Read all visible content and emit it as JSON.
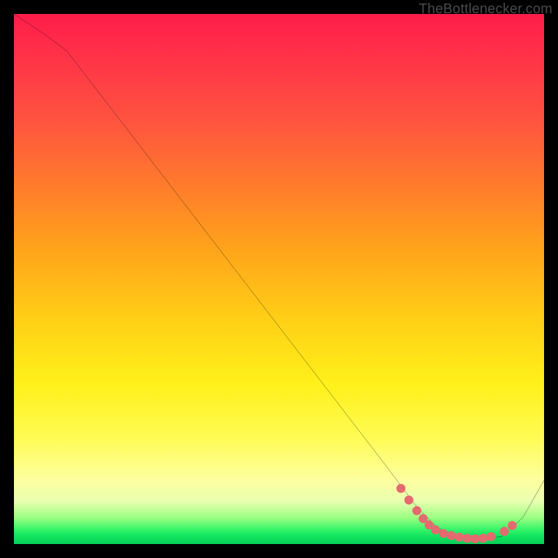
{
  "watermark": "TheBottlenecker.com",
  "chart_data": {
    "type": "line",
    "title": "",
    "xlabel": "",
    "ylabel": "",
    "xlim": [
      0,
      100
    ],
    "ylim": [
      0,
      100
    ],
    "series": [
      {
        "name": "curve",
        "x": [
          0,
          6,
          10,
          20,
          30,
          40,
          50,
          60,
          70,
          76,
          80,
          84,
          88,
          92,
          96,
          100
        ],
        "y": [
          100,
          96,
          93,
          80,
          67,
          54,
          41,
          28,
          15,
          7,
          3,
          1.4,
          1.0,
          1.4,
          5,
          12
        ]
      }
    ],
    "markers": [
      {
        "x": 73.0,
        "y": 10.5
      },
      {
        "x": 74.5,
        "y": 8.3
      },
      {
        "x": 76.0,
        "y": 6.3
      },
      {
        "x": 77.2,
        "y": 4.8
      },
      {
        "x": 78.3,
        "y": 3.6
      },
      {
        "x": 79.5,
        "y": 2.7
      },
      {
        "x": 81.0,
        "y": 2.0
      },
      {
        "x": 82.5,
        "y": 1.6
      },
      {
        "x": 84.0,
        "y": 1.3
      },
      {
        "x": 85.5,
        "y": 1.1
      },
      {
        "x": 87.0,
        "y": 1.0
      },
      {
        "x": 88.5,
        "y": 1.1
      },
      {
        "x": 90.0,
        "y": 1.4
      },
      {
        "x": 92.5,
        "y": 2.4
      },
      {
        "x": 94.0,
        "y": 3.5
      }
    ],
    "marker_color": "#e46a6f",
    "curve_color": "#000000"
  }
}
